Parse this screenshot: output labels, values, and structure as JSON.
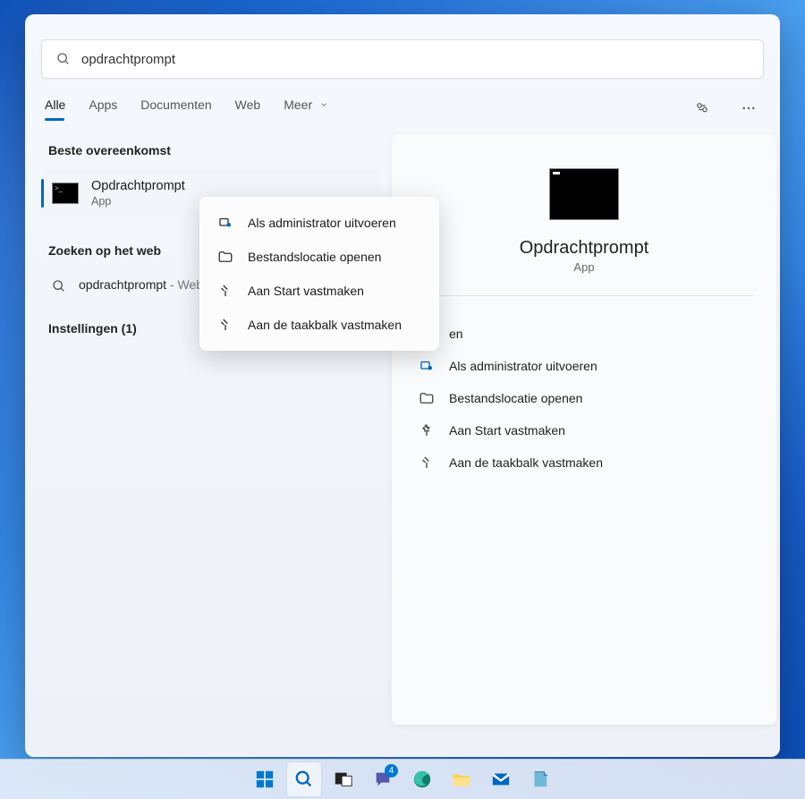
{
  "search": {
    "value": "opdrachtprompt"
  },
  "tabs": {
    "all": "Alle",
    "apps": "Apps",
    "documents": "Documenten",
    "web": "Web",
    "more": "Meer"
  },
  "best_match_heading": "Beste overeenkomst",
  "best_match": {
    "title": "Opdrachtprompt",
    "subtitle": "App"
  },
  "web_heading": "Zoeken op het web",
  "web_result": {
    "term": "opdrachtprompt",
    "suffix": " - Webresultaten weergeven"
  },
  "settings_heading": "Instellingen (1)",
  "detail": {
    "name": "Opdrachtprompt",
    "type": "App",
    "open_truncated": "en",
    "actions": {
      "run_admin": "Als administrator uitvoeren",
      "open_location": "Bestandslocatie openen",
      "pin_start": "Aan Start vastmaken",
      "pin_taskbar": "Aan de taakbalk vastmaken"
    }
  },
  "context_menu": {
    "run_admin": "Als administrator uitvoeren",
    "open_location": "Bestandslocatie openen",
    "pin_start": "Aan Start vastmaken",
    "pin_taskbar": "Aan de taakbalk vastmaken"
  },
  "taskbar": {
    "chat_badge": "4"
  }
}
